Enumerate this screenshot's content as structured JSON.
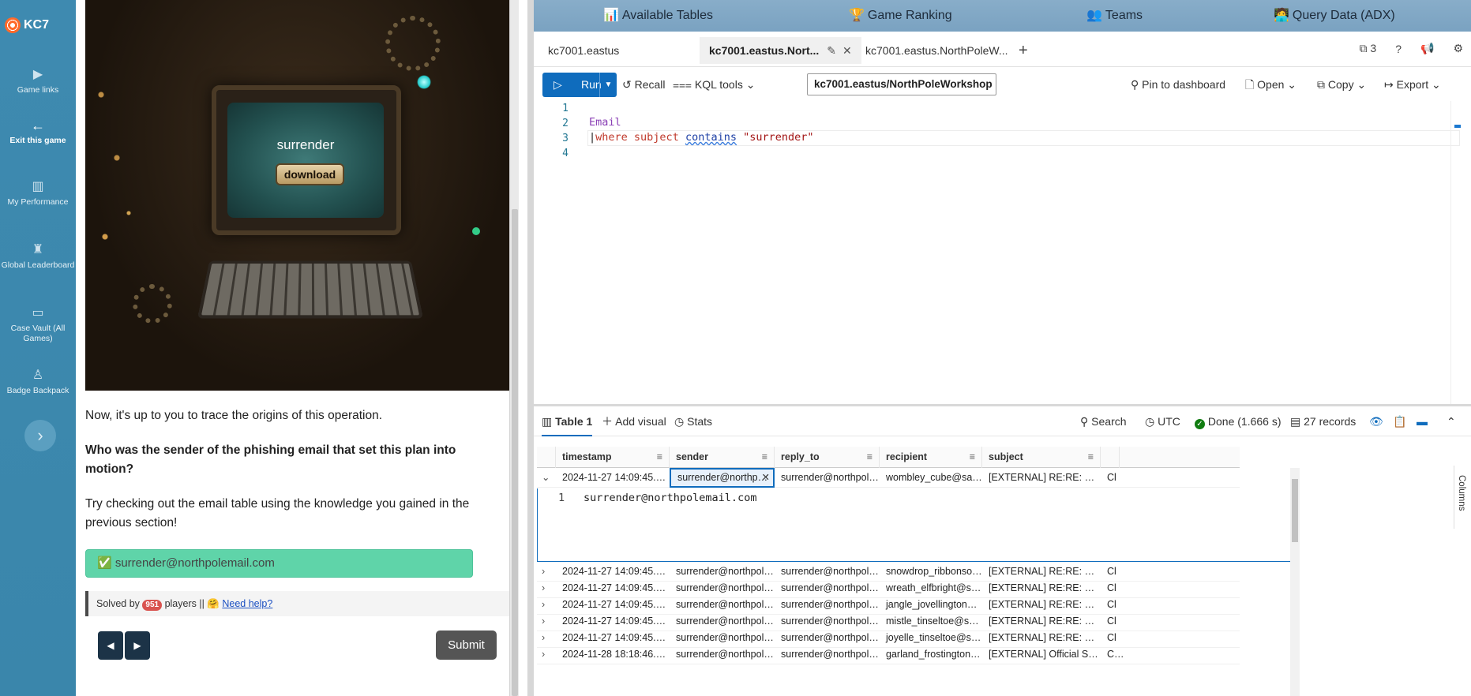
{
  "rail": {
    "logo": "KC7",
    "items": [
      {
        "label": "Game links",
        "icon": "play-icon"
      },
      {
        "label": "Exit this game",
        "icon": "arrow-left-icon"
      },
      {
        "label": "My Performance",
        "icon": "bar-chart-icon"
      },
      {
        "label": "Global Leaderboard",
        "icon": "trophy-icon"
      },
      {
        "label": "Case Vault (All Games)",
        "icon": "vault-icon"
      },
      {
        "label": "Badge Backpack",
        "icon": "badge-icon"
      }
    ],
    "expand": "›"
  },
  "lesson": {
    "art": {
      "screen_title": "surrender",
      "button": "download"
    },
    "intro": "Now, it's up to you to trace the origins of this operation.",
    "question": "Who was the sender of the phishing email that set this plan into motion?",
    "hint": "Try checking out the email table using the knowledge you gained in the previous section!",
    "answer": "✅ surrender@northpolemail.com",
    "solved_prefix": "Solved by",
    "solved_count": "951",
    "solved_suffix": "players ||",
    "help_emoji": "🤗",
    "help_link": "Need help?",
    "prev": "◀",
    "next": "▶",
    "submit": "Submit"
  },
  "topnav": {
    "items": [
      {
        "icon": "📊",
        "label": "Available Tables"
      },
      {
        "icon": "🏆",
        "label": "Game Ranking"
      },
      {
        "icon": "👥",
        "label": "Teams"
      },
      {
        "icon": "🧑‍💻",
        "label": "Query Data (ADX)"
      }
    ]
  },
  "tabs": {
    "items": [
      "kc7001.eastus",
      "kc7001.eastus.Nort...",
      "kc7001.eastus.NorthPoleW..."
    ],
    "plus": "+",
    "count": "3",
    "help": "?"
  },
  "toolbar": {
    "run": "Run",
    "recall": "Recall",
    "kql_tools": "KQL tools",
    "cluster": "kc7001.eastus/NorthPoleWorkshop",
    "pin": "Pin to dashboard",
    "open": "Open",
    "copy": "Copy",
    "export": "Export"
  },
  "editor": {
    "line_numbers": [
      "1",
      "2",
      "3",
      "4"
    ],
    "table": "Email",
    "pipe": "|",
    "where": "where",
    "field": "subject",
    "op": "contains",
    "value": "\"surrender\""
  },
  "results": {
    "tab": "Table 1",
    "add_visual": "Add visual",
    "stats": "Stats",
    "search": "Search",
    "utc": "UTC",
    "done": "Done (1.666 s)",
    "records": "27 records",
    "columns_label": "Columns",
    "headers": [
      "timestamp",
      "sender",
      "reply_to",
      "recipient",
      "subject"
    ],
    "detail_line": "1",
    "detail_value": "surrender@northpolemail.com",
    "rows": [
      {
        "timestamp": "2024-11-27 14:09:45.0000",
        "sender": "surrender@northpol...",
        "reply_to": "surrender@northpole...",
        "recipient": "wombley_cube@sant...",
        "subject": "[EXTERNAL] RE:RE: Officia...",
        "extra": "Cl"
      },
      {
        "timestamp": "2024-11-27 14:09:45.0000",
        "sender": "surrender@northpole...",
        "reply_to": "surrender@northpole...",
        "recipient": "snowdrop_ribbonson...",
        "subject": "[EXTERNAL] RE:RE: Officia...",
        "extra": "Cl"
      },
      {
        "timestamp": "2024-11-27 14:09:45.0000",
        "sender": "surrender@northpole...",
        "reply_to": "surrender@northpole...",
        "recipient": "wreath_elfbright@sa...",
        "subject": "[EXTERNAL] RE:RE: Officia...",
        "extra": "Cl"
      },
      {
        "timestamp": "2024-11-27 14:09:45.0000",
        "sender": "surrender@northpole...",
        "reply_to": "surrender@northpole...",
        "recipient": "jangle_jovellington@...",
        "subject": "[EXTERNAL] RE:RE: Officia...",
        "extra": "Cl"
      },
      {
        "timestamp": "2024-11-27 14:09:45.0000",
        "sender": "surrender@northpole...",
        "reply_to": "surrender@northpole...",
        "recipient": "mistle_tinseltoe@san...",
        "subject": "[EXTERNAL] RE:RE: Officia...",
        "extra": "Cl"
      },
      {
        "timestamp": "2024-11-27 14:09:45.0000",
        "sender": "surrender@northpole...",
        "reply_to": "surrender@northpole...",
        "recipient": "joyelle_tinseltoe@san...",
        "subject": "[EXTERNAL] RE:RE: Officia...",
        "extra": "Cl"
      },
      {
        "timestamp": "2024-11-28 18:18:46.0000",
        "sender": "surrender@northpole...",
        "reply_to": "surrender@northpole...",
        "recipient": "garland_frostington@...",
        "subject": "[EXTERNAL] Official Surre...",
        "extra": "Cl h..."
      }
    ]
  },
  "colors": {
    "rail": "#3a87ad",
    "run": "#0f6cbd",
    "answer": "#5fd4a9",
    "topnav": "#7fa6c5"
  }
}
